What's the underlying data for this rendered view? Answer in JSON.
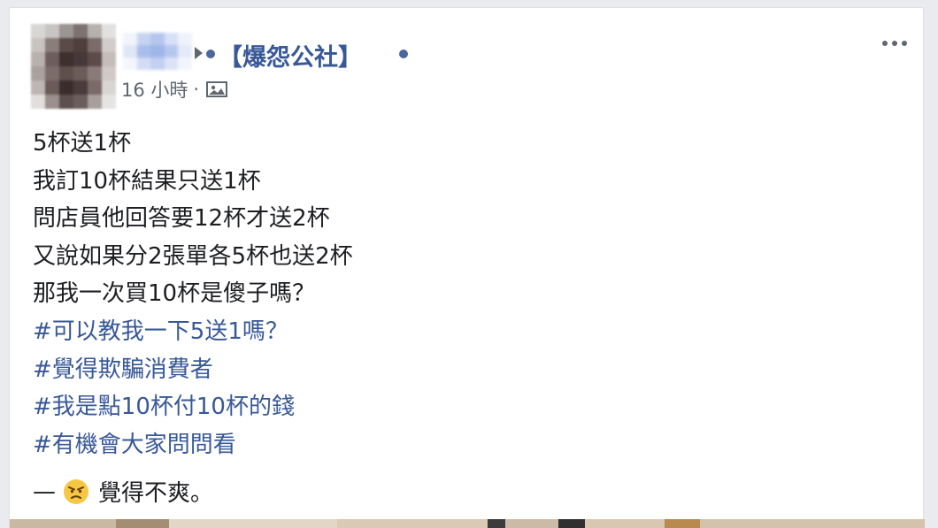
{
  "post": {
    "group_name": "【爆怨公社】",
    "time": "16 小時",
    "separator": "·",
    "privacy_icon": "photo-icon",
    "more_icon": "more-options-icon",
    "lines": [
      "5杯送1杯",
      "我訂10杯結果只送1杯",
      "問店員他回答要12杯才送2杯",
      "又說如果分2張單各5杯也送2杯",
      "那我一次買10杯是傻子嗎？"
    ],
    "hashtags": [
      "#可以教我一下5送1嗎？",
      "#覺得欺騙消費者",
      "#我是點10杯付10杯的錢",
      "#有機會大家問問看"
    ],
    "feeling": {
      "dash": "—",
      "emoji_icon": "angry-face-icon",
      "text": "覺得不爽。"
    }
  },
  "colors": {
    "link": "#385898",
    "text": "#1c1e21",
    "meta": "#606770",
    "background": "#e9ebee"
  }
}
